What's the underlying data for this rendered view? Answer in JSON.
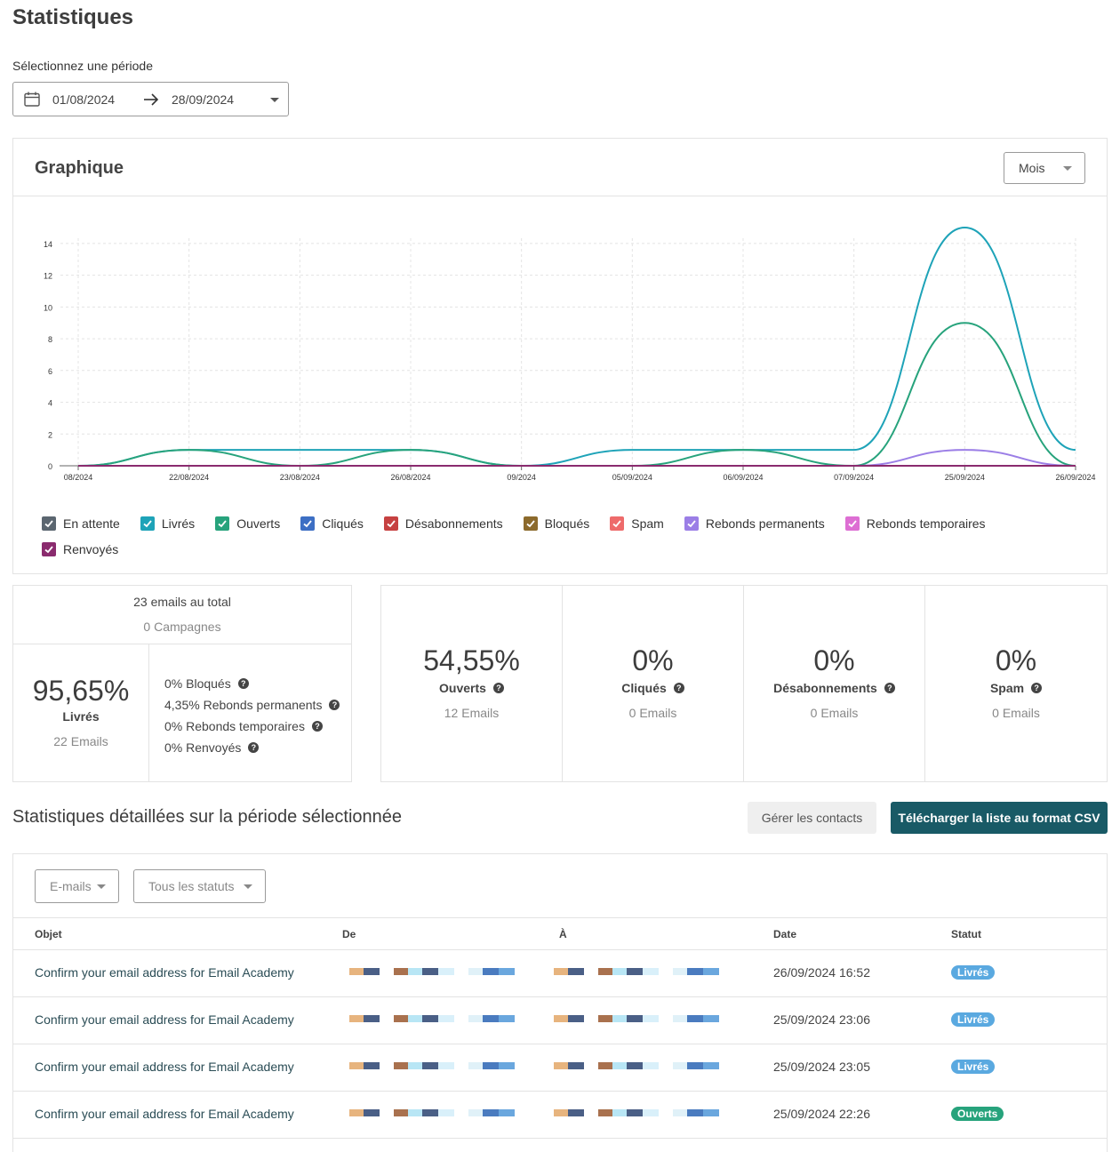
{
  "page": {
    "title": "Statistiques",
    "period_label": "Sélectionnez une période",
    "date_start": "01/08/2024",
    "date_end": "28/09/2024"
  },
  "chart_card": {
    "title": "Graphique",
    "granularity": "Mois"
  },
  "chart_data": {
    "type": "line",
    "x": [
      "08/2024",
      "22/08/2024",
      "23/08/2024",
      "26/08/2024",
      "09/2024",
      "05/09/2024",
      "06/09/2024",
      "07/09/2024",
      "25/09/2024",
      "26/09/2024"
    ],
    "ylim": [
      0,
      15
    ],
    "yticks": [
      0,
      2,
      4,
      6,
      8,
      10,
      12,
      14
    ],
    "grid": true,
    "series": [
      {
        "name": "Livrés",
        "color": "#1ea3b8",
        "values": [
          0,
          1,
          1,
          1,
          0,
          1,
          1,
          1,
          15,
          1
        ]
      },
      {
        "name": "Ouverts",
        "color": "#27a37c",
        "values": [
          0,
          1,
          0,
          1,
          0,
          0,
          1,
          0,
          9,
          0
        ]
      },
      {
        "name": "Rebonds permanents",
        "color": "#9b7ee6",
        "values": [
          0,
          0,
          0,
          0,
          0,
          0,
          0,
          0,
          1,
          0
        ]
      },
      {
        "name": "Renvoyés",
        "color": "#8a2b6e",
        "values": [
          0,
          0,
          0,
          0,
          0,
          0,
          0,
          0,
          0,
          0
        ]
      }
    ]
  },
  "legend": [
    {
      "label": "En attente",
      "color": "#5b6670"
    },
    {
      "label": "Livrés",
      "color": "#1ea3b8"
    },
    {
      "label": "Ouverts",
      "color": "#27a37c"
    },
    {
      "label": "Cliqués",
      "color": "#3d6fc4"
    },
    {
      "label": "Désabonnements",
      "color": "#c64141"
    },
    {
      "label": "Bloqués",
      "color": "#8c6a2c"
    },
    {
      "label": "Spam",
      "color": "#ee6b6b"
    },
    {
      "label": "Rebonds permanents",
      "color": "#9b7ee6"
    },
    {
      "label": "Rebonds temporaires",
      "color": "#dd6ed3"
    },
    {
      "label": "Renvoyés",
      "color": "#8a2b6e"
    }
  ],
  "totals": {
    "total_emails": "23 emails au total",
    "campaigns": "0 Campagnes",
    "delivered_pct": "95,65%",
    "delivered_label": "Livrés",
    "delivered_count": "22 Emails",
    "blocked": "0% Bloqués",
    "hard_bounces": "4,35% Rebonds permanents",
    "soft_bounces": "0% Rebonds temporaires",
    "resent": "0% Renvoyés"
  },
  "stats": [
    {
      "pct": "54,55%",
      "label": "Ouverts",
      "count": "12 Emails"
    },
    {
      "pct": "0%",
      "label": "Cliqués",
      "count": "0 Emails"
    },
    {
      "pct": "0%",
      "label": "Désabonnements",
      "count": "0 Emails"
    },
    {
      "pct": "0%",
      "label": "Spam",
      "count": "0 Emails"
    }
  ],
  "details": {
    "title": "Statistiques détaillées sur la période sélectionnée",
    "manage_contacts": "Gérer les contacts",
    "download_csv": "Télécharger la liste au format CSV",
    "filter_type": "E-mails",
    "filter_status": "Tous les statuts",
    "headers": {
      "subject": "Objet",
      "from": "De",
      "to": "À",
      "date": "Date",
      "status": "Statut"
    },
    "rows": [
      {
        "subject": "Confirm your email address for Email Academy",
        "date": "26/09/2024 16:52",
        "status": "Livrés",
        "status_color": "#5aa9e0"
      },
      {
        "subject": "Confirm your email address for Email Academy",
        "date": "25/09/2024 23:06",
        "status": "Livrés",
        "status_color": "#5aa9e0"
      },
      {
        "subject": "Confirm your email address for Email Academy",
        "date": "25/09/2024 23:05",
        "status": "Livrés",
        "status_color": "#5aa9e0"
      },
      {
        "subject": "Confirm your email address for Email Academy",
        "date": "25/09/2024 22:26",
        "status": "Ouverts",
        "status_color": "#27a37c"
      }
    ]
  }
}
